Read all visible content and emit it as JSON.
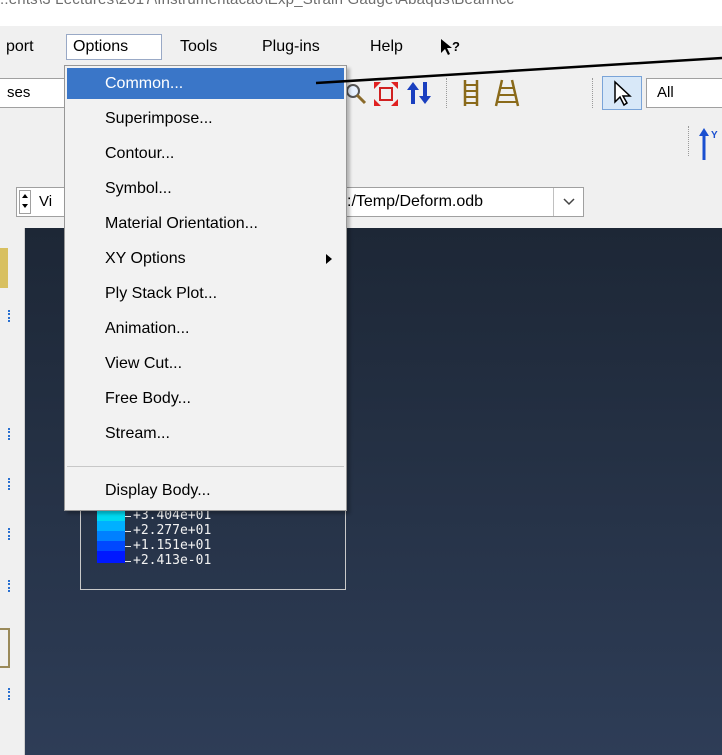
{
  "window": {
    "title_fragment": "..ents\\3 Lectures\\2017\\Instrumentacao\\Exp_Strain Gauge\\Abaqus\\Beam\\cc"
  },
  "menubar": {
    "items": [
      "port",
      "Options",
      "Tools",
      "Plug-ins",
      "Help"
    ],
    "help_pointer_glyph": "▲?"
  },
  "toolbar": {
    "steps_label": "ses",
    "selection_filter": "All",
    "icons": [
      "zoom-icon",
      "fit-view-icon",
      "swap-icon",
      "rails-icon",
      "ladder-icon",
      "select-arrow-icon"
    ]
  },
  "context_bar": {
    "module_label": "Vi",
    "odb_path": ":/Temp/Deform.odb"
  },
  "options_menu": {
    "items": [
      {
        "label": "Common...",
        "highlighted": true,
        "submenu": false
      },
      {
        "label": "Superimpose...",
        "highlighted": false,
        "submenu": false
      },
      {
        "label": "Contour...",
        "highlighted": false,
        "submenu": false
      },
      {
        "label": "Symbol...",
        "highlighted": false,
        "submenu": false
      },
      {
        "label": "Material Orientation...",
        "highlighted": false,
        "submenu": false
      },
      {
        "label": "XY Options",
        "highlighted": false,
        "submenu": true
      },
      {
        "label": "Ply Stack Plot...",
        "highlighted": false,
        "submenu": false
      },
      {
        "label": "Animation...",
        "highlighted": false,
        "submenu": false
      },
      {
        "label": "View Cut...",
        "highlighted": false,
        "submenu": false
      },
      {
        "label": "Free Body...",
        "highlighted": false,
        "submenu": false
      },
      {
        "label": "Stream...",
        "highlighted": false,
        "submenu": false
      },
      {
        "label": "Display Body...",
        "highlighted": false,
        "submenu": false
      }
    ]
  },
  "legend": {
    "labels": [
      "+3.404e+01",
      "+2.277e+01",
      "+1.151e+01",
      "+2.413e-01"
    ],
    "colors": [
      "#00d8f0",
      "#0090ff",
      "#0048ff",
      "#0010ff"
    ]
  },
  "colors": {
    "highlight": "#3a76c8",
    "viewport_top": "#1d2736",
    "viewport_bottom": "#2e3d57"
  }
}
